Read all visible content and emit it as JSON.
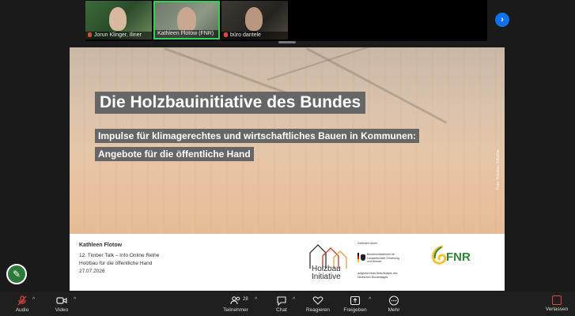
{
  "participants": [
    {
      "name": "Jorun Klinger, Iliner",
      "muted": true
    },
    {
      "name": "Kathleen Flotow (FNR)",
      "muted": false
    },
    {
      "name": "büro dantele",
      "muted": true
    }
  ],
  "slide": {
    "title": "Die Holzbauinitiative des Bundes",
    "subtitle_line1": "Impulse für klimagerechtes und wirtschaftliches Bauen in Kommunen:",
    "subtitle_line2": "Angebote für die öffentliche Hand",
    "photo_credit": "Foto: Holzbau Initiative",
    "presenter": "Kathleen Flotow",
    "event": "12. Timber Talk – Info Online Reihe",
    "topic": "Holzbau für die öffentliche Hand",
    "date": "27.07.2026",
    "logos": {
      "holzbau_line1": "Holzbau",
      "holzbau_line2": "Initiative",
      "bmel_top": "Gefördert durch:",
      "bmel_name": "Bundesministerium für Landwirtschaft, Ernährung und Heimat",
      "bmel_bottom": "aufgrund eines Beschlusses des Deutschen Bundestages",
      "fnr": "FNR"
    }
  },
  "toolbar": {
    "audio": "Audio",
    "video": "Video",
    "participants": "Teilnehmer",
    "participant_count": "28",
    "chat": "Chat",
    "react": "Reagieren",
    "share": "Freigeben",
    "more": "Mehr",
    "leave": "Verlassen"
  },
  "colors": {
    "accent": "#0e72ed",
    "muted_red": "#e0453b",
    "speaker_border": "#30d158",
    "title_box": "#666666",
    "fnr_green": "#2a8a3a"
  }
}
